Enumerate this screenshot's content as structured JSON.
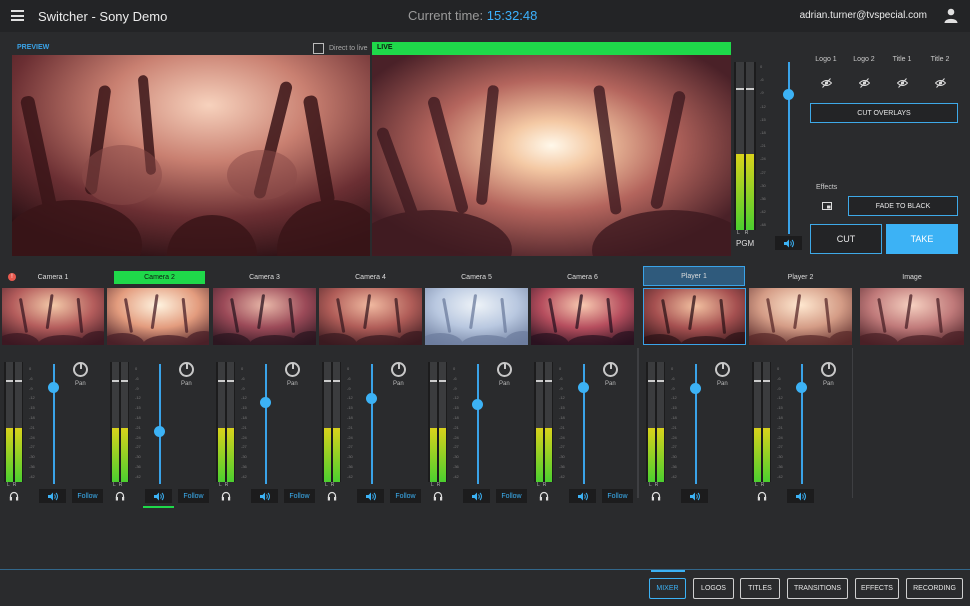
{
  "header": {
    "title": "Switcher - Sony Demo",
    "time_label": "Current time:",
    "time_value": "15:32:48",
    "user_email": "adrian.turner@tvspecial.com"
  },
  "preview": {
    "label": "PREVIEW",
    "direct_label": "Direct to live"
  },
  "live": {
    "label": "LIVE"
  },
  "pgm": {
    "label": "PGM",
    "l": "L",
    "r": "R",
    "db_scale": [
      "0",
      "-6",
      "-9",
      "-12",
      "-15",
      "-18",
      "-21",
      "-24",
      "-27",
      "-30",
      "-36",
      "-42",
      "-48"
    ]
  },
  "overlays": {
    "items": [
      "Logo 1",
      "Logo 2",
      "Title 1",
      "Title 2"
    ],
    "cut_label": "CUT OVERLAYS"
  },
  "effects": {
    "label": "Effects",
    "fade_label": "FADE TO BLACK"
  },
  "transition": {
    "cut_label": "CUT",
    "take_label": "TAKE"
  },
  "sources": [
    {
      "label": "Camera 1",
      "state": "warning"
    },
    {
      "label": "Camera 2",
      "state": "live"
    },
    {
      "label": "Camera 3",
      "state": ""
    },
    {
      "label": "Camera 4",
      "state": ""
    },
    {
      "label": "Camera 5",
      "state": ""
    },
    {
      "label": "Camera 6",
      "state": ""
    },
    {
      "label": "Player 1",
      "state": "preview"
    },
    {
      "label": "Player 2",
      "state": ""
    },
    {
      "label": "Image",
      "state": ""
    }
  ],
  "mixer": {
    "pan_label": "Pan",
    "follow_label": "Follow",
    "db_scale": [
      "0",
      "-6",
      "-9",
      "-12",
      "-15",
      "-18",
      "-21",
      "-24",
      "-27",
      "-30",
      "-36",
      "-42"
    ]
  },
  "tabs": [
    "MIXER",
    "LOGOS",
    "TITLES",
    "TRANSITIONS",
    "EFFECTS",
    "RECORDING"
  ],
  "colors": {
    "accent": "#3cb2f5",
    "live": "#1fd94a",
    "warning": "#e85a4f"
  }
}
